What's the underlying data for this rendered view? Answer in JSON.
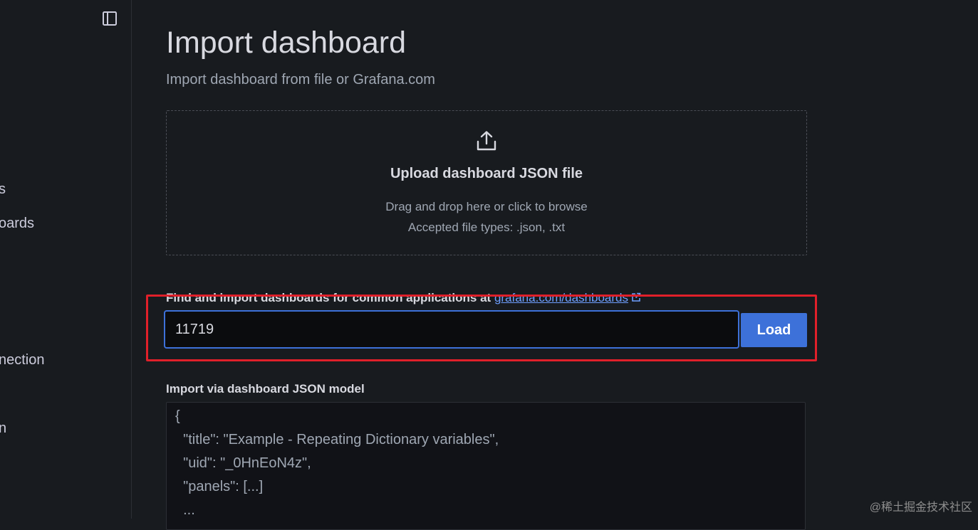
{
  "sidebar": {
    "items": [
      "s",
      "oards",
      "nection",
      "n"
    ]
  },
  "page": {
    "title": "Import dashboard",
    "subtitle": "Import dashboard from file or Grafana.com"
  },
  "upload": {
    "icon": "upload-icon",
    "title": "Upload dashboard JSON file",
    "hint_line1": "Drag and drop here or click to browse",
    "hint_line2": "Accepted file types: .json, .txt"
  },
  "grafana_import": {
    "label_text": "Find and import dashboards for common applications at",
    "link_text": "grafana.com/dashboards",
    "input_value": "11719",
    "load_label": "Load"
  },
  "json_model": {
    "label": "Import via dashboard JSON model",
    "lines": [
      "{",
      "  \"title\": \"Example - Repeating Dictionary variables\",",
      "  \"uid\": \"_0HnEoN4z\",",
      "  \"panels\": [...]",
      "  ..."
    ]
  },
  "watermark": "@稀土掘金技术社区",
  "colors": {
    "background": "#181b1f",
    "primary": "#3d71d9",
    "link": "#6e9fff",
    "highlight": "#e0202a"
  }
}
